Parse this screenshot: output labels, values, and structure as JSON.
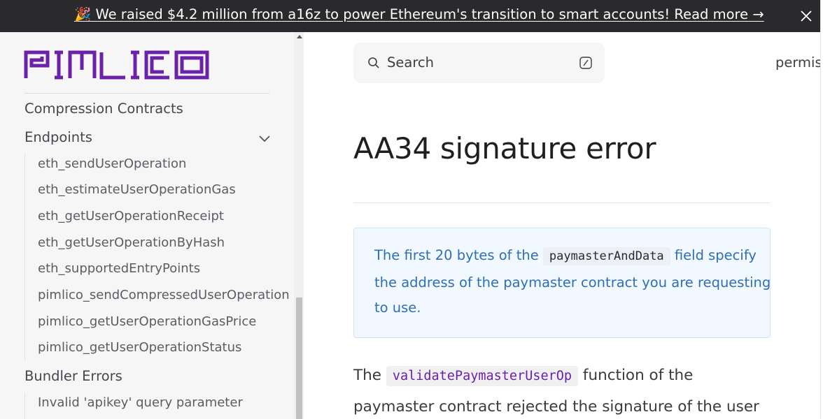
{
  "banner": {
    "text": "🎉 We raised $4.2 million from a16z to power Ethereum's transition to smart accounts! Read more →",
    "close_icon": "close-icon"
  },
  "sidebar": {
    "logo_text": "PIMLICO",
    "brand_color": "#6b21a8",
    "sections": [
      {
        "label": "Compression Contracts"
      },
      {
        "label": "Endpoints",
        "expanded": true
      },
      {
        "label": "Bundler Errors"
      }
    ],
    "endpoints": [
      "eth_sendUserOperation",
      "eth_estimateUserOperationGas",
      "eth_getUserOperationReceipt",
      "eth_getUserOperationByHash",
      "eth_supportedEntryPoints",
      "pimlico_sendCompressedUserOperation",
      "pimlico_getUserOperationGasPrice",
      "pimlico_getUserOperationStatus"
    ],
    "bundler_errors": [
      "Invalid 'apikey' query parameter"
    ]
  },
  "header": {
    "search_placeholder": "Search",
    "search_icon": "search-icon",
    "shortcut_icon": "slash-key-icon",
    "nav_link": "permis"
  },
  "main": {
    "title": "AA34 signature error",
    "callout": {
      "line1_before": "The first 20 bytes of the",
      "line1_code": "paymasterAndData",
      "line1_after": "field specify",
      "line2": "the address of the paymaster contract you are requesting",
      "line3": "to use."
    },
    "body": {
      "line1_before": "The",
      "line1_code": "validatePaymasterUserOp",
      "line1_after": "function of the",
      "line2": "paymaster contract rejected the signature of the user"
    }
  }
}
